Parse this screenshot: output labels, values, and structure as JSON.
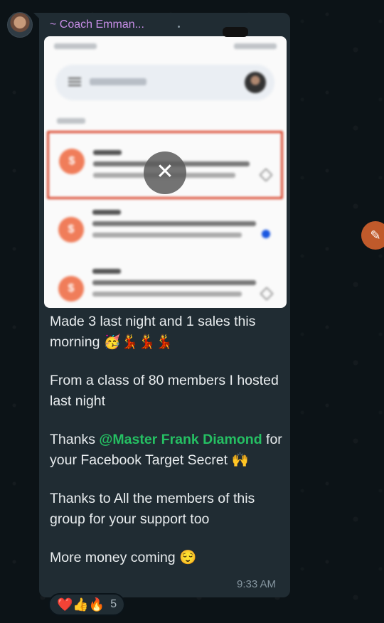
{
  "chat": {
    "sender_name": "~ Coach Emman...",
    "screenshot_close_icon": "close-icon",
    "message_lines": {
      "p1": "Made 3 last night and 1 sales this morning 🥳💃💃💃",
      "p2": "From a class of 80 members I hosted last night",
      "p3_prefix": "Thanks ",
      "p3_mention": "@Master Frank Diamond",
      "p3_suffix": " for your Facebook Target Secret 🙌",
      "p4": "Thanks to All the members of this group for your support too",
      "p5": "More money coming 😌"
    },
    "time": "9:33 AM",
    "reactions": {
      "emojis": "❤️👍🔥",
      "count": "5"
    }
  },
  "colors": {
    "bubble": "#202c33",
    "sender": "#c88ee8",
    "mention": "#25c063",
    "highlight_border": "#d9442b"
  }
}
